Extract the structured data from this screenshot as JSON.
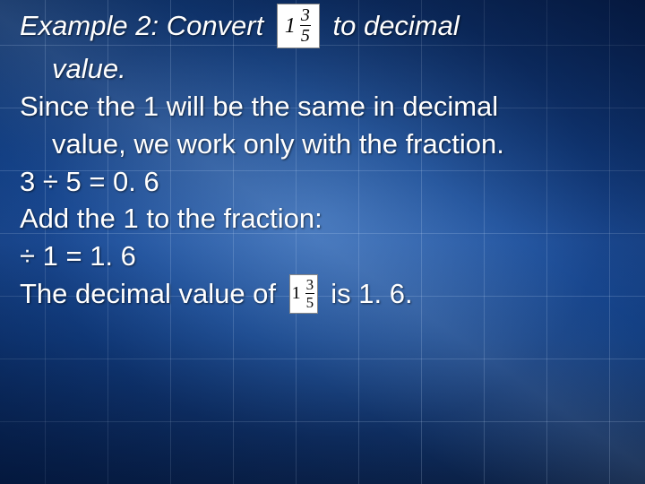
{
  "line1_a": "Example 2: Convert",
  "line1_b": "to decimal",
  "line2": "value.",
  "line3": "Since the 1 will be the same in decimal",
  "line4": "value, we work only with the fraction.",
  "line5": "3 ÷ 5 =  0. 6",
  "line6": "Add the 1 to the fraction:",
  "line7": "÷ 1 =    1. 6",
  "line8_a": "The decimal value of",
  "line8_b": "is 1. 6.",
  "frac1": {
    "whole": "1",
    "num": "3",
    "den": "5"
  },
  "frac2": {
    "whole": "1",
    "num": "3",
    "den": "5"
  }
}
